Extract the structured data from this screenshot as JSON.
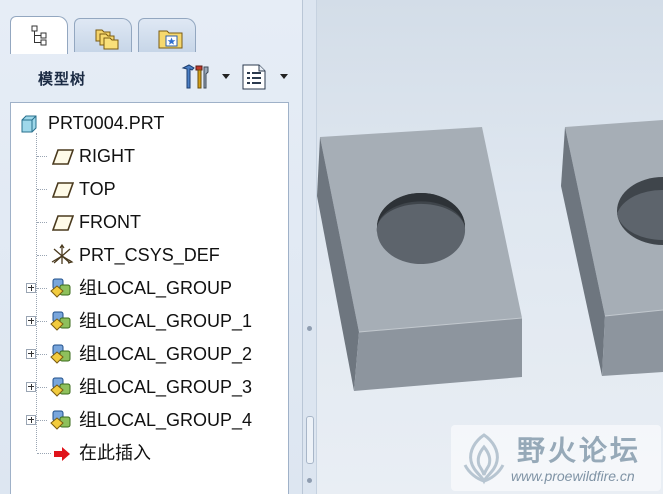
{
  "panel": {
    "title": "模型树",
    "tabs": [
      {
        "icon": "model-tree-tab-icon",
        "active": true
      },
      {
        "icon": "folder-browser-tab-icon",
        "active": false
      },
      {
        "icon": "favorites-tab-icon",
        "active": false
      }
    ],
    "settings_icon": "tools-settings-icon",
    "show_icon": "tree-columns-icon"
  },
  "tree": {
    "root": {
      "label": "PRT0004.PRT",
      "icon": "part-icon"
    },
    "items": [
      {
        "label": "RIGHT",
        "icon": "datum-plane-icon",
        "expandable": false
      },
      {
        "label": "TOP",
        "icon": "datum-plane-icon",
        "expandable": false
      },
      {
        "label": "FRONT",
        "icon": "datum-plane-icon",
        "expandable": false
      },
      {
        "label": "PRT_CSYS_DEF",
        "icon": "coordinate-system-icon",
        "expandable": false
      },
      {
        "label": "组LOCAL_GROUP",
        "icon": "group-icon",
        "expandable": true
      },
      {
        "label": "组LOCAL_GROUP_1",
        "icon": "group-icon",
        "expandable": true
      },
      {
        "label": "组LOCAL_GROUP_2",
        "icon": "group-icon",
        "expandable": true
      },
      {
        "label": "组LOCAL_GROUP_3",
        "icon": "group-icon",
        "expandable": true
      },
      {
        "label": "组LOCAL_GROUP_4",
        "icon": "group-icon",
        "expandable": true
      },
      {
        "label": "在此插入",
        "icon": "insert-here-arrow-icon",
        "expandable": false
      }
    ]
  },
  "watermark": {
    "title": "野火论坛",
    "url": "www.proewildfire.cn"
  },
  "colors": {
    "model_face_front": "#8b949e",
    "model_face_top": "#a3abb3",
    "model_face_side": "#6e767f",
    "insert_arrow": "#e0131b"
  }
}
